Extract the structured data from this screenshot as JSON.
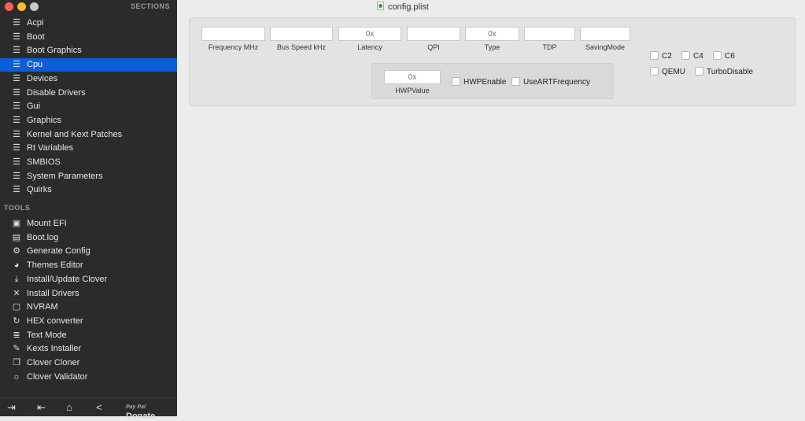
{
  "window": {
    "title": "config.plist",
    "colors": {
      "close": "#fe5f57",
      "minimize": "#febc2e",
      "zoom": "#c8c8c8",
      "selection": "#0a5fd8"
    }
  },
  "sidebar": {
    "sections_header": "SECTIONS",
    "sections": [
      {
        "label": "Acpi"
      },
      {
        "label": "Boot"
      },
      {
        "label": "Boot Graphics"
      },
      {
        "label": "Cpu",
        "selected": true
      },
      {
        "label": "Devices"
      },
      {
        "label": "Disable Drivers"
      },
      {
        "label": "Gui"
      },
      {
        "label": "Graphics"
      },
      {
        "label": "Kernel and Kext Patches"
      },
      {
        "label": "Rt Variables"
      },
      {
        "label": "SMBIOS"
      },
      {
        "label": "System Parameters"
      },
      {
        "label": "Quirks"
      }
    ],
    "tools_header": "TOOLS",
    "tools": [
      {
        "label": "Mount EFI",
        "icon": "disk-icon"
      },
      {
        "label": "Boot.log",
        "icon": "log-icon"
      },
      {
        "label": "Generate Config",
        "icon": "gears-icon"
      },
      {
        "label": "Themes Editor",
        "icon": "palette-icon"
      },
      {
        "label": "Install/Update Clover",
        "icon": "download-icon"
      },
      {
        "label": "Install Drivers",
        "icon": "tools-icon"
      },
      {
        "label": "NVRAM",
        "icon": "chip-icon"
      },
      {
        "label": "HEX converter",
        "icon": "refresh-icon"
      },
      {
        "label": "Text Mode",
        "icon": "text-icon"
      },
      {
        "label": "Kexts Installer",
        "icon": "plug-icon"
      },
      {
        "label": "Clover Cloner",
        "icon": "copy-icon"
      },
      {
        "label": "Clover Validator",
        "icon": "bulb-icon"
      }
    ],
    "footer": {
      "donate_label": "Donate",
      "paypal_label": "Pay Pal"
    }
  },
  "cpu": {
    "fields": [
      {
        "label": "Frequency MHz",
        "value": "",
        "placeholder": ""
      },
      {
        "label": "Bus Speed kHz",
        "value": "",
        "placeholder": ""
      },
      {
        "label": "Latency",
        "value": "",
        "placeholder": "0x"
      },
      {
        "label": "QPI",
        "value": "",
        "placeholder": ""
      },
      {
        "label": "Type",
        "value": "",
        "placeholder": "0x"
      },
      {
        "label": "TDP",
        "value": "",
        "placeholder": ""
      },
      {
        "label": "SavingMode",
        "value": "",
        "placeholder": ""
      }
    ],
    "hwp": {
      "label": "HWPValue",
      "placeholder": "0x",
      "value": ""
    },
    "checkboxes": [
      {
        "label": "HWPEnable",
        "checked": false
      },
      {
        "label": "UseARTFrequency",
        "checked": false
      },
      {
        "label": "C2",
        "checked": false
      },
      {
        "label": "C4",
        "checked": false
      },
      {
        "label": "C6",
        "checked": false
      },
      {
        "label": "QEMU",
        "checked": false
      },
      {
        "label": "TurboDisable",
        "checked": false
      }
    ]
  }
}
